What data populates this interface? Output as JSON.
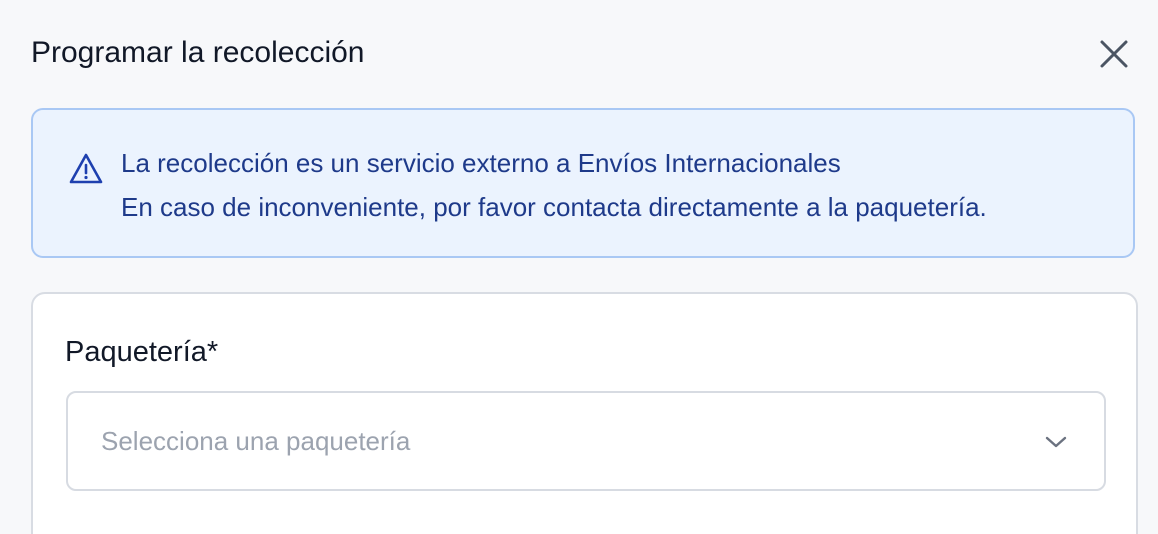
{
  "dialog": {
    "title": "Programar la recolección",
    "close_icon": "close-icon"
  },
  "alert": {
    "icon": "warning-icon",
    "line1": "La recolección es un servicio externo a Envíos Internacionales",
    "line2": "En caso de inconveniente, por favor contacta directamente a la paquetería."
  },
  "form": {
    "carrier_label": "Paquetería*",
    "carrier_placeholder": "Selecciona una paquetería",
    "chevron_icon": "chevron-down-icon"
  },
  "colors": {
    "background": "#f7f8fa",
    "alert_background": "#ebf3fe",
    "alert_border": "#a9c8f4",
    "alert_text": "#1e3a8a",
    "placeholder_text": "#9ca3af"
  }
}
